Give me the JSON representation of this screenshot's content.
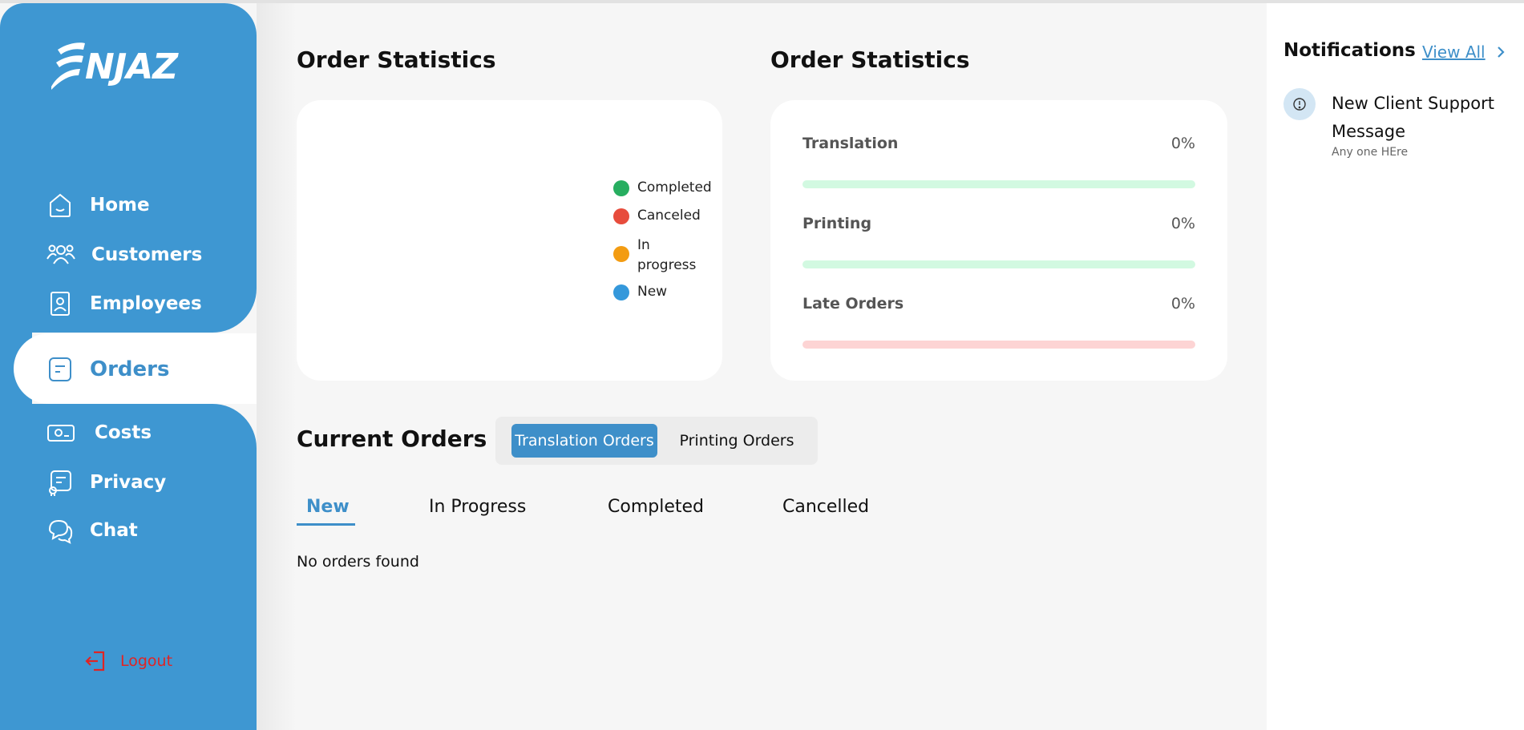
{
  "brand": {
    "logo_text": "NJAZ"
  },
  "sidebar": {
    "items": [
      {
        "label": "Home",
        "icon": "home-icon"
      },
      {
        "label": "Customers",
        "icon": "users-icon"
      },
      {
        "label": "Employees",
        "icon": "id-badge-icon"
      },
      {
        "label": "Orders",
        "icon": "document-icon",
        "active": true
      },
      {
        "label": "Costs",
        "icon": "cash-icon"
      },
      {
        "label": "Privacy",
        "icon": "policy-icon"
      },
      {
        "label": "Chat",
        "icon": "chat-icon"
      }
    ],
    "logout_label": "Logout"
  },
  "stats_chart": {
    "title": "Order Statistics",
    "legend": [
      {
        "label": "Completed",
        "color": "#27ae60"
      },
      {
        "label": "Canceled",
        "color": "#e74c3c"
      },
      {
        "label": "In progress",
        "color": "#f39c12"
      },
      {
        "label": "New",
        "color": "#3498db"
      }
    ]
  },
  "chart_data": {
    "type": "pie",
    "categories": [
      "Completed",
      "Canceled",
      "In progress",
      "New"
    ],
    "values": [
      0,
      0,
      0,
      0
    ],
    "legend": "right"
  },
  "stats_progress": {
    "title": "Order Statistics",
    "items": [
      {
        "label": "Translation",
        "value": "0%",
        "fraction": 0,
        "track_color": "#d2f9e1"
      },
      {
        "label": "Printing",
        "value": "0%",
        "fraction": 0,
        "track_color": "#d2f9e1"
      },
      {
        "label": "Late Orders",
        "value": "0%",
        "fraction": 0,
        "track_color": "#fdd4d4"
      }
    ]
  },
  "orders": {
    "title": "Current Orders",
    "toggle": [
      "Translation Orders",
      "Printing Orders"
    ],
    "tabs": [
      "New",
      "In Progress",
      "Completed",
      "Cancelled"
    ],
    "empty_text": "No orders found"
  },
  "notifications": {
    "title": "Notifications",
    "view_all": "View All",
    "items": [
      {
        "title": "New Client Support Message",
        "subtitle": "Any one HEre",
        "icon": "support-icon"
      }
    ]
  },
  "colors": {
    "accent": "#3e97d2",
    "logout": "#e02424"
  }
}
